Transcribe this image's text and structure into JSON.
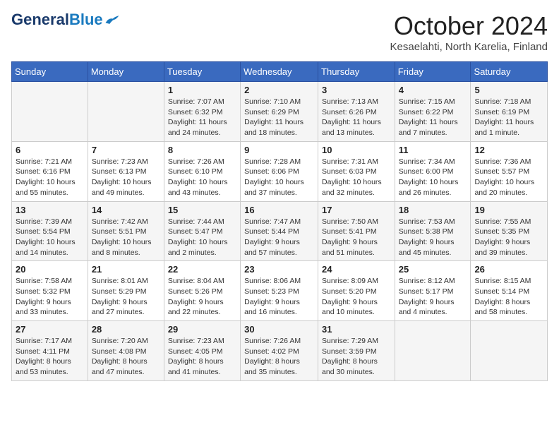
{
  "header": {
    "logo_general": "General",
    "logo_blue": "Blue",
    "month_title": "October 2024",
    "location": "Kesaelahti, North Karelia, Finland"
  },
  "days_of_week": [
    "Sunday",
    "Monday",
    "Tuesday",
    "Wednesday",
    "Thursday",
    "Friday",
    "Saturday"
  ],
  "weeks": [
    [
      {
        "num": "",
        "sunrise": "",
        "sunset": "",
        "daylight": ""
      },
      {
        "num": "",
        "sunrise": "",
        "sunset": "",
        "daylight": ""
      },
      {
        "num": "1",
        "sunrise": "Sunrise: 7:07 AM",
        "sunset": "Sunset: 6:32 PM",
        "daylight": "Daylight: 11 hours and 24 minutes."
      },
      {
        "num": "2",
        "sunrise": "Sunrise: 7:10 AM",
        "sunset": "Sunset: 6:29 PM",
        "daylight": "Daylight: 11 hours and 18 minutes."
      },
      {
        "num": "3",
        "sunrise": "Sunrise: 7:13 AM",
        "sunset": "Sunset: 6:26 PM",
        "daylight": "Daylight: 11 hours and 13 minutes."
      },
      {
        "num": "4",
        "sunrise": "Sunrise: 7:15 AM",
        "sunset": "Sunset: 6:22 PM",
        "daylight": "Daylight: 11 hours and 7 minutes."
      },
      {
        "num": "5",
        "sunrise": "Sunrise: 7:18 AM",
        "sunset": "Sunset: 6:19 PM",
        "daylight": "Daylight: 11 hours and 1 minute."
      }
    ],
    [
      {
        "num": "6",
        "sunrise": "Sunrise: 7:21 AM",
        "sunset": "Sunset: 6:16 PM",
        "daylight": "Daylight: 10 hours and 55 minutes."
      },
      {
        "num": "7",
        "sunrise": "Sunrise: 7:23 AM",
        "sunset": "Sunset: 6:13 PM",
        "daylight": "Daylight: 10 hours and 49 minutes."
      },
      {
        "num": "8",
        "sunrise": "Sunrise: 7:26 AM",
        "sunset": "Sunset: 6:10 PM",
        "daylight": "Daylight: 10 hours and 43 minutes."
      },
      {
        "num": "9",
        "sunrise": "Sunrise: 7:28 AM",
        "sunset": "Sunset: 6:06 PM",
        "daylight": "Daylight: 10 hours and 37 minutes."
      },
      {
        "num": "10",
        "sunrise": "Sunrise: 7:31 AM",
        "sunset": "Sunset: 6:03 PM",
        "daylight": "Daylight: 10 hours and 32 minutes."
      },
      {
        "num": "11",
        "sunrise": "Sunrise: 7:34 AM",
        "sunset": "Sunset: 6:00 PM",
        "daylight": "Daylight: 10 hours and 26 minutes."
      },
      {
        "num": "12",
        "sunrise": "Sunrise: 7:36 AM",
        "sunset": "Sunset: 5:57 PM",
        "daylight": "Daylight: 10 hours and 20 minutes."
      }
    ],
    [
      {
        "num": "13",
        "sunrise": "Sunrise: 7:39 AM",
        "sunset": "Sunset: 5:54 PM",
        "daylight": "Daylight: 10 hours and 14 minutes."
      },
      {
        "num": "14",
        "sunrise": "Sunrise: 7:42 AM",
        "sunset": "Sunset: 5:51 PM",
        "daylight": "Daylight: 10 hours and 8 minutes."
      },
      {
        "num": "15",
        "sunrise": "Sunrise: 7:44 AM",
        "sunset": "Sunset: 5:47 PM",
        "daylight": "Daylight: 10 hours and 2 minutes."
      },
      {
        "num": "16",
        "sunrise": "Sunrise: 7:47 AM",
        "sunset": "Sunset: 5:44 PM",
        "daylight": "Daylight: 9 hours and 57 minutes."
      },
      {
        "num": "17",
        "sunrise": "Sunrise: 7:50 AM",
        "sunset": "Sunset: 5:41 PM",
        "daylight": "Daylight: 9 hours and 51 minutes."
      },
      {
        "num": "18",
        "sunrise": "Sunrise: 7:53 AM",
        "sunset": "Sunset: 5:38 PM",
        "daylight": "Daylight: 9 hours and 45 minutes."
      },
      {
        "num": "19",
        "sunrise": "Sunrise: 7:55 AM",
        "sunset": "Sunset: 5:35 PM",
        "daylight": "Daylight: 9 hours and 39 minutes."
      }
    ],
    [
      {
        "num": "20",
        "sunrise": "Sunrise: 7:58 AM",
        "sunset": "Sunset: 5:32 PM",
        "daylight": "Daylight: 9 hours and 33 minutes."
      },
      {
        "num": "21",
        "sunrise": "Sunrise: 8:01 AM",
        "sunset": "Sunset: 5:29 PM",
        "daylight": "Daylight: 9 hours and 27 minutes."
      },
      {
        "num": "22",
        "sunrise": "Sunrise: 8:04 AM",
        "sunset": "Sunset: 5:26 PM",
        "daylight": "Daylight: 9 hours and 22 minutes."
      },
      {
        "num": "23",
        "sunrise": "Sunrise: 8:06 AM",
        "sunset": "Sunset: 5:23 PM",
        "daylight": "Daylight: 9 hours and 16 minutes."
      },
      {
        "num": "24",
        "sunrise": "Sunrise: 8:09 AM",
        "sunset": "Sunset: 5:20 PM",
        "daylight": "Daylight: 9 hours and 10 minutes."
      },
      {
        "num": "25",
        "sunrise": "Sunrise: 8:12 AM",
        "sunset": "Sunset: 5:17 PM",
        "daylight": "Daylight: 9 hours and 4 minutes."
      },
      {
        "num": "26",
        "sunrise": "Sunrise: 8:15 AM",
        "sunset": "Sunset: 5:14 PM",
        "daylight": "Daylight: 8 hours and 58 minutes."
      }
    ],
    [
      {
        "num": "27",
        "sunrise": "Sunrise: 7:17 AM",
        "sunset": "Sunset: 4:11 PM",
        "daylight": "Daylight: 8 hours and 53 minutes."
      },
      {
        "num": "28",
        "sunrise": "Sunrise: 7:20 AM",
        "sunset": "Sunset: 4:08 PM",
        "daylight": "Daylight: 8 hours and 47 minutes."
      },
      {
        "num": "29",
        "sunrise": "Sunrise: 7:23 AM",
        "sunset": "Sunset: 4:05 PM",
        "daylight": "Daylight: 8 hours and 41 minutes."
      },
      {
        "num": "30",
        "sunrise": "Sunrise: 7:26 AM",
        "sunset": "Sunset: 4:02 PM",
        "daylight": "Daylight: 8 hours and 35 minutes."
      },
      {
        "num": "31",
        "sunrise": "Sunrise: 7:29 AM",
        "sunset": "Sunset: 3:59 PM",
        "daylight": "Daylight: 8 hours and 30 minutes."
      },
      {
        "num": "",
        "sunrise": "",
        "sunset": "",
        "daylight": ""
      },
      {
        "num": "",
        "sunrise": "",
        "sunset": "",
        "daylight": ""
      }
    ]
  ]
}
